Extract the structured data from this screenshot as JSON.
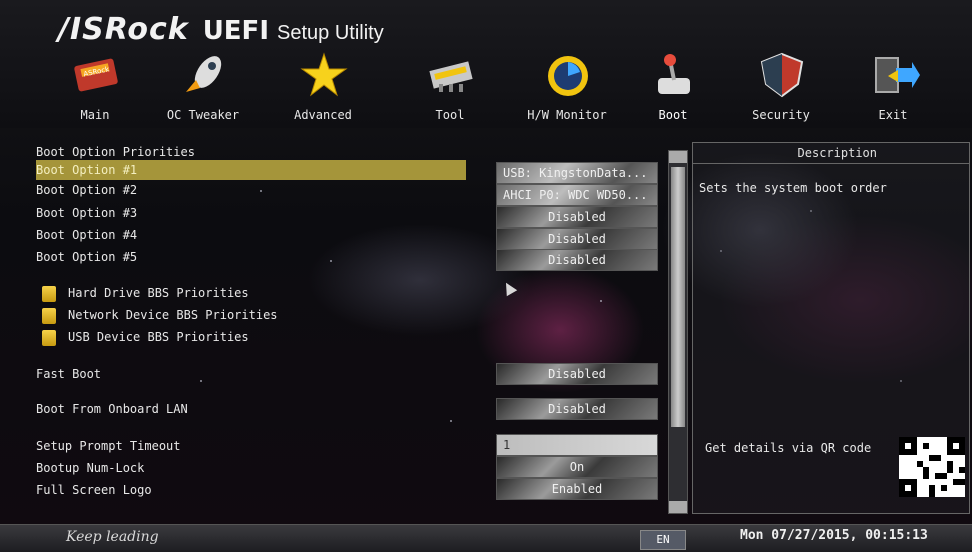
{
  "brand": {
    "logo": "/ISRock",
    "uefi": "UEFI",
    "setup": "Setup Utility"
  },
  "tabs": [
    {
      "label": "Main",
      "icon": "main-icon"
    },
    {
      "label": "OC Tweaker",
      "icon": "rocket-icon"
    },
    {
      "label": "Advanced",
      "icon": "star-icon"
    },
    {
      "label": "Tool",
      "icon": "tool-icon"
    },
    {
      "label": "H/W Monitor",
      "icon": "monitor-icon"
    },
    {
      "label": "Boot",
      "icon": "joystick-icon"
    },
    {
      "label": "Security",
      "icon": "shield-icon"
    },
    {
      "label": "Exit",
      "icon": "exit-icon"
    }
  ],
  "section_title": "Boot Option Priorities",
  "boot_options": [
    {
      "label": "Boot Option #1",
      "value": "USB: KingstonData..."
    },
    {
      "label": "Boot Option #2",
      "value": "AHCI P0: WDC WD50..."
    },
    {
      "label": "Boot Option #3",
      "value": "Disabled"
    },
    {
      "label": "Boot Option #4",
      "value": "Disabled"
    },
    {
      "label": "Boot Option #5",
      "value": "Disabled"
    }
  ],
  "bbs": [
    {
      "label": "Hard Drive BBS Priorities"
    },
    {
      "label": "Network Device BBS Priorities"
    },
    {
      "label": "USB Device BBS Priorities"
    }
  ],
  "settings": [
    {
      "label": "Fast Boot",
      "value": "Disabled"
    },
    {
      "label": "Boot From Onboard LAN",
      "value": "Disabled"
    },
    {
      "label": "Setup Prompt Timeout",
      "value": "1"
    },
    {
      "label": "Bootup Num-Lock",
      "value": "On"
    },
    {
      "label": "Full Screen Logo",
      "value": "Enabled"
    }
  ],
  "description": {
    "title": "Description",
    "text": "Sets the system boot order",
    "qr_label": "Get details via QR code"
  },
  "footer": {
    "motto": "Keep leading",
    "language": "EN",
    "datetime": "Mon 07/27/2015, 00:15:13"
  },
  "colors": {
    "selection": "#a5953a",
    "folder": "#f6d24a"
  }
}
